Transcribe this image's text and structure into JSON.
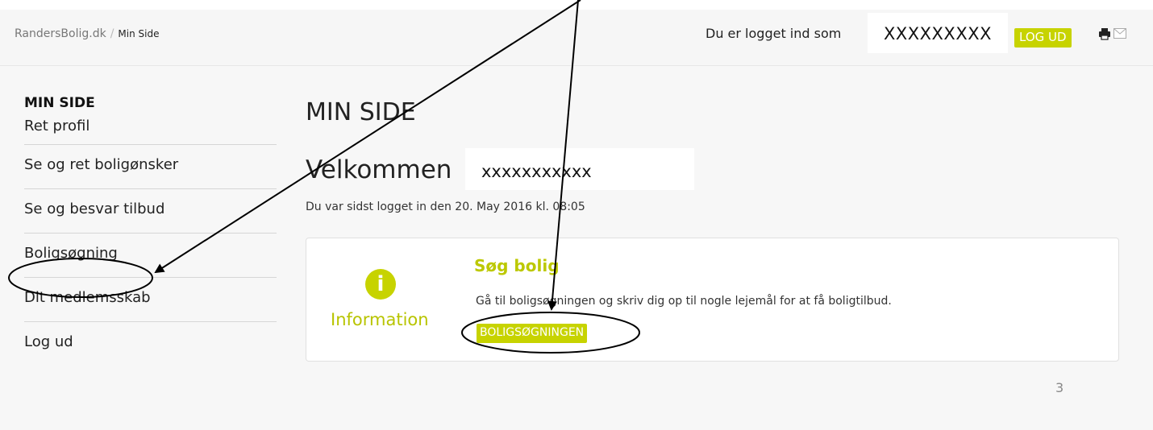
{
  "header": {
    "breadcrumb_site": "RandersBolig.dk",
    "breadcrumb_separator": "/",
    "breadcrumb_current": "Min Side",
    "login_text": "Du er logget ind som",
    "username": "XXXXXXXXX",
    "logout_label": "LOG UD",
    "icons": [
      "print-icon",
      "mail-icon"
    ]
  },
  "sidebar": {
    "title": "MIN SIDE",
    "items": [
      {
        "label": "Ret profil"
      },
      {
        "label": "Se og ret boligønsker"
      },
      {
        "label": "Se og besvar tilbud"
      },
      {
        "label": "Boligsøgning"
      },
      {
        "label": "Dit medlemsskab"
      },
      {
        "label": "Log ud"
      }
    ]
  },
  "main": {
    "page_title": "MIN SIDE",
    "welcome_label": "Velkommen",
    "welcome_name": "xxxxxxxxxxx",
    "last_login": "Du var sidst logget in den 20. May 2016 kl. 08:05",
    "info_card": {
      "icon": "info-icon",
      "icon_glyph": "i",
      "label": "Information",
      "title": "Søg bolig",
      "text": "Gå til boligsøgningen og skriv dig op til nogle lejemål for at få boligtilbud.",
      "button_label": "BOLIGSØGNINGEN"
    }
  },
  "page_number": "3",
  "colors": {
    "accent": "#c7d300",
    "background": "#f7f7f7",
    "annotation": "#000000"
  }
}
